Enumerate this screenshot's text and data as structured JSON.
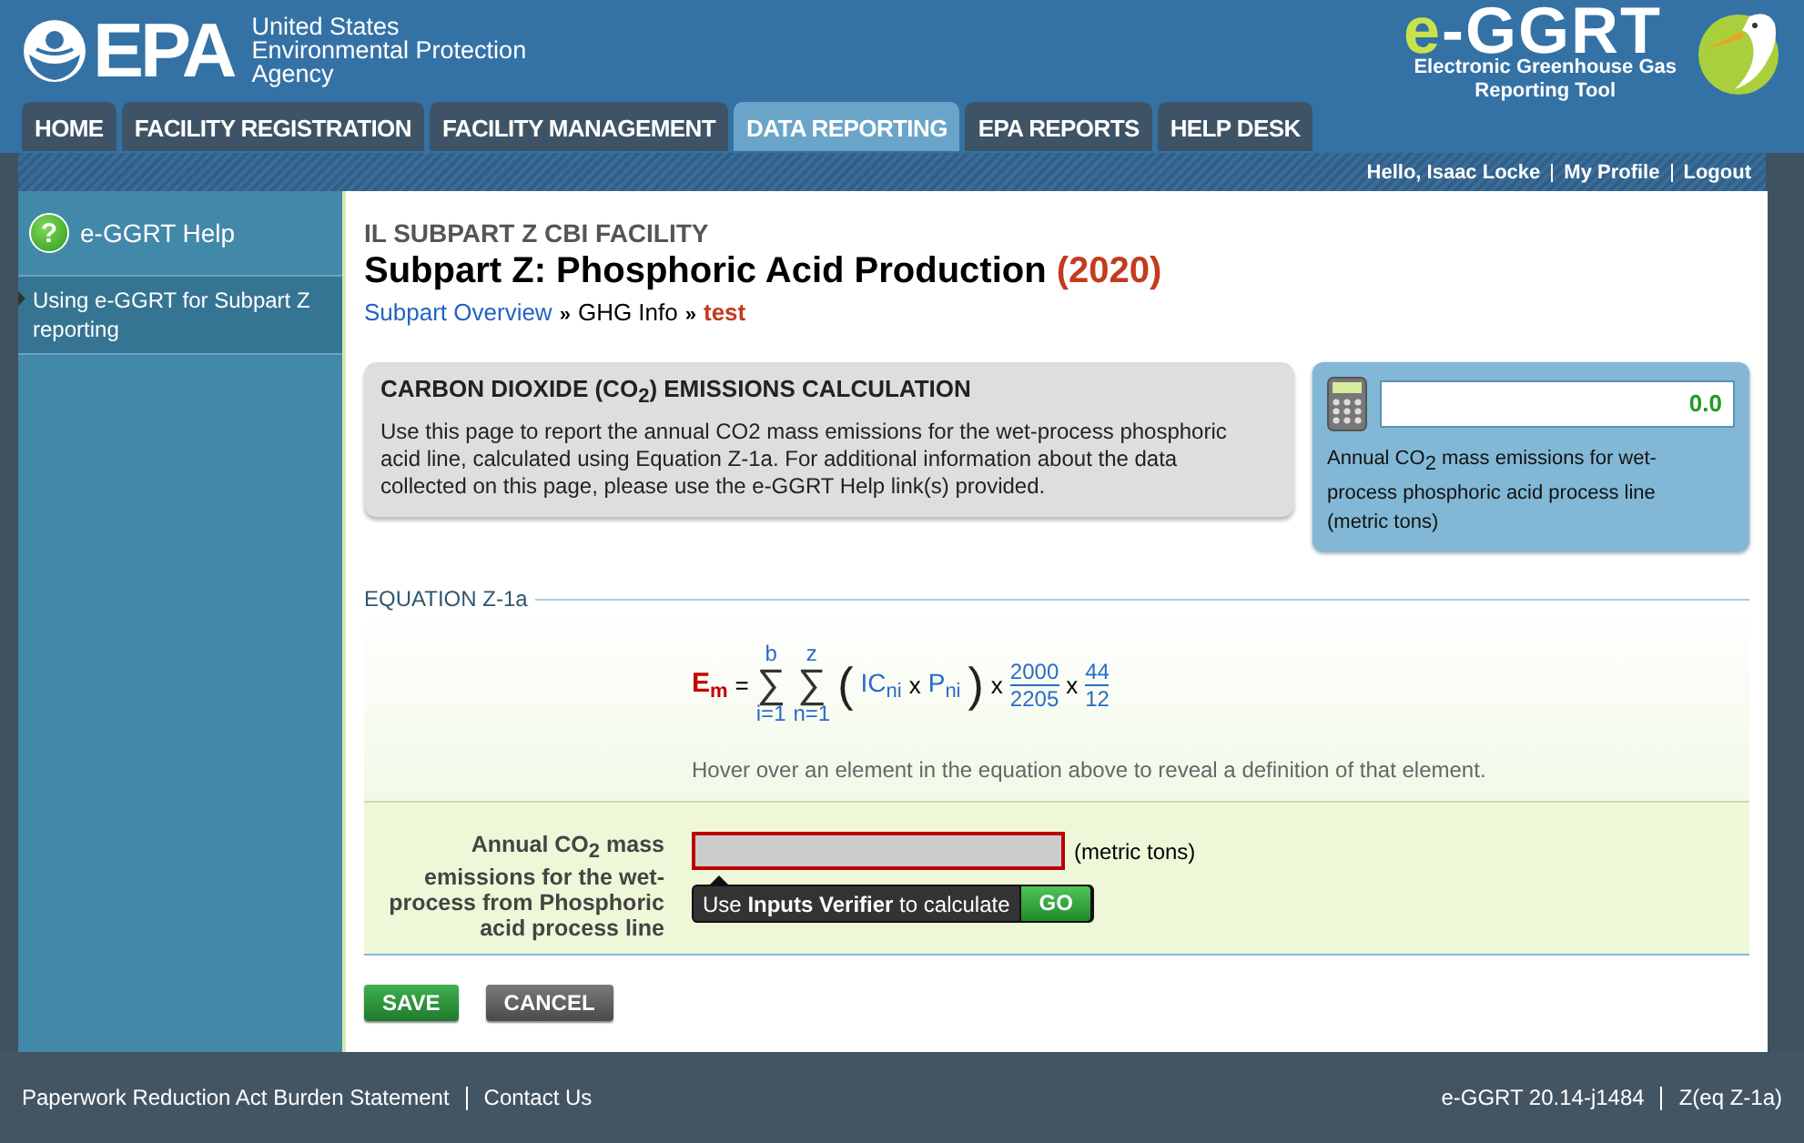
{
  "header": {
    "agency_lines": [
      "United States",
      "Environmental Protection",
      "Agency"
    ],
    "logo_text": "EPA",
    "app_logo": {
      "accent": "e",
      "rest": "-GGRT"
    },
    "app_name_lines": [
      "Electronic Greenhouse Gas",
      "Reporting Tool"
    ]
  },
  "tabs": [
    {
      "label": "HOME",
      "selected": false
    },
    {
      "label": "FACILITY REGISTRATION",
      "selected": false
    },
    {
      "label": "FACILITY MANAGEMENT",
      "selected": false
    },
    {
      "label": "DATA REPORTING",
      "selected": true
    },
    {
      "label": "EPA REPORTS",
      "selected": false
    },
    {
      "label": "HELP DESK",
      "selected": false
    }
  ],
  "user_bar": {
    "greeting": "Hello, Isaac Locke",
    "links": [
      "My Profile",
      "Logout"
    ]
  },
  "sidebar": {
    "icon": "?",
    "title": "e-GGRT Help",
    "items": [
      {
        "label": "Using e-GGRT for Subpart Z reporting",
        "selected": true
      }
    ]
  },
  "content": {
    "facility": "IL SUBPART Z CBI FACILITY",
    "title": "Subpart Z: Phosphoric Acid Production",
    "year": "(2020)",
    "breadcrumb": [
      {
        "label": "Subpart Overview",
        "kind": "link"
      },
      {
        "label": "GHG Info",
        "kind": "text"
      },
      {
        "label": "test",
        "kind": "current"
      }
    ],
    "breadcrumb_separator": "»",
    "info_box": {
      "heading": "CARBON DIOXIDE (CO$_{2}$) EMISSIONS CALCULATION",
      "text": "Use this page to report the annual CO2 mass emissions for the wet-process phosphoric acid line, calculated using Equation Z-1a. For additional information about the data collected on this page, please use the e-GGRT Help link(s) provided."
    },
    "total_box": {
      "value": "0.0",
      "label": "Annual CO$_{2}$ mass emissions for wet-process phosphoric acid process line (metric tons)"
    },
    "equation": {
      "heading": "EQUATION Z-1a",
      "terms": [
        {
          "kind": "result",
          "text": "E",
          "sub": "m"
        },
        {
          "kind": "op",
          "text": "="
        },
        {
          "kind": "sum",
          "upper": "b",
          "sign": "∑",
          "lower": "i=1"
        },
        {
          "kind": "sum",
          "upper": "z",
          "sign": "∑",
          "lower": "n=1"
        },
        {
          "kind": "paren",
          "text": "("
        },
        {
          "kind": "variable",
          "text": "IC",
          "sub": "ni"
        },
        {
          "kind": "op",
          "text": "x"
        },
        {
          "kind": "variable",
          "text": "P",
          "sub": "ni"
        },
        {
          "kind": "paren",
          "text": ")"
        },
        {
          "kind": "op",
          "text": "x"
        },
        {
          "kind": "fraction",
          "num": "2000",
          "den": "2205"
        },
        {
          "kind": "op",
          "text": "x"
        },
        {
          "kind": "fraction",
          "num": "44",
          "den": "12"
        }
      ],
      "hint": "Hover over an element in the equation above to reveal a definition of that element."
    },
    "form": {
      "label": "Annual CO$_{2}$ mass emissions for the wet-process from Phosphoric acid process line",
      "invalid": true,
      "unit": "(metric tons)",
      "verifier_text": "Use **Inputs Verifier** to calculate",
      "verifier_button": "GO"
    },
    "buttons": [
      {
        "label": "SAVE",
        "kind": "primary"
      },
      {
        "label": "CANCEL",
        "kind": "secondary"
      }
    ]
  },
  "footer": {
    "left_links": [
      "Paperwork Reduction Act Burden Statement",
      "Contact Us"
    ],
    "right_texts": [
      "e-GGRT 20.14-j1484",
      "Z(eq Z-1a)"
    ]
  }
}
